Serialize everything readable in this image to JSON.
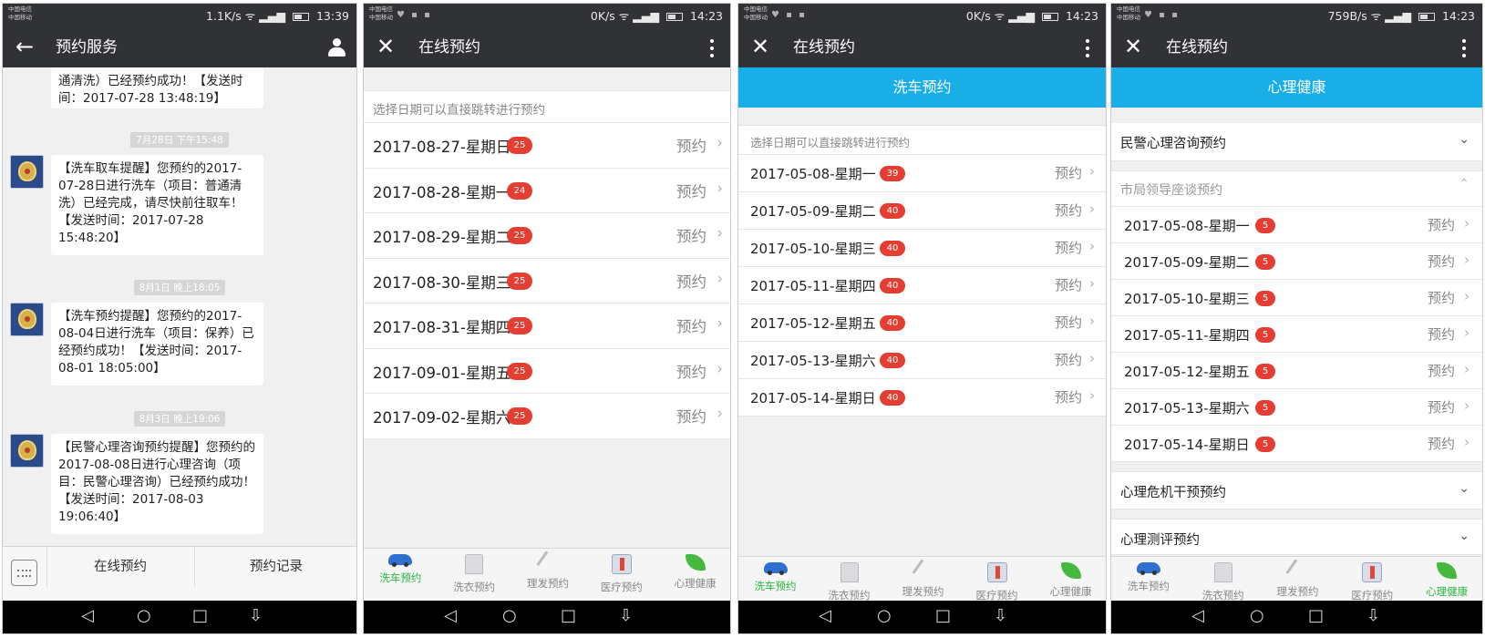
{
  "colors": {
    "accent_blue": "#1AAEE8",
    "badge_red": "#E43E32",
    "tab_active_green": "#2BB63D",
    "bar_dark": "#303236"
  },
  "screens": [
    {
      "status": {
        "carrier1": "中国电信",
        "carrier2": "中国移动",
        "speed": "1.1K/s",
        "time": "13:39"
      },
      "header": {
        "back_icon": "←",
        "title": "预约服务",
        "profile_icon": "person-icon"
      },
      "messages": [
        {
          "text": "通清洗）已经预约成功！【发送时间：2017-07-28 13:48:19】"
        },
        {
          "stamp": "7月28日 下午15:48",
          "text": "【洗车取车提醒】您预约的2017-07-28日进行洗车（项目：普通清洗）已经完成，请尽快前往取车！【发送时间：2017-07-28 15:48:20】"
        },
        {
          "stamp": "8月1日 晚上18:05",
          "text": "【洗车预约提醒】您预约的2017-08-04日进行洗车（项目：保养）已经预约成功！【发送时间：2017-08-01 18:05:00】"
        },
        {
          "stamp": "8月3日 晚上19:06",
          "text": "【民警心理咨询预约提醒】您预约的2017-08-08日进行心理咨询（项目：民警心理咨询）已经预约成功！【发送时间：2017-08-03 19:06:40】"
        }
      ],
      "bottom": {
        "left": "在线预约",
        "right": "预约记录"
      }
    },
    {
      "status": {
        "carrier1": "中国电信",
        "carrier2": "中国移动",
        "speed": "0K/s",
        "time": "14:23"
      },
      "header": {
        "title": "在线预约"
      },
      "hint": "选择日期可以直接跳转进行预约",
      "rows": [
        {
          "date": "2017-08-27-星期日",
          "count": "25"
        },
        {
          "date": "2017-08-28-星期一",
          "count": "24"
        },
        {
          "date": "2017-08-29-星期二",
          "count": "25"
        },
        {
          "date": "2017-08-30-星期三",
          "count": "25"
        },
        {
          "date": "2017-08-31-星期四",
          "count": "25"
        },
        {
          "date": "2017-09-01-星期五",
          "count": "25"
        },
        {
          "date": "2017-09-02-星期六",
          "count": "25"
        }
      ],
      "action": "预约",
      "tabs": [
        "洗车预约",
        "洗衣预约",
        "理发预约",
        "医疗预约",
        "心理健康"
      ]
    },
    {
      "status": {
        "carrier1": "中国电信",
        "carrier2": "中国移动",
        "speed": "0K/s",
        "time": "14:23"
      },
      "header": {
        "title": "在线预约"
      },
      "banner": "洗车预约",
      "hint": "选择日期可以直接跳转进行预约",
      "rows": [
        {
          "date": "2017-05-08-星期一",
          "count": "39"
        },
        {
          "date": "2017-05-09-星期二",
          "count": "40"
        },
        {
          "date": "2017-05-10-星期三",
          "count": "40"
        },
        {
          "date": "2017-05-11-星期四",
          "count": "40"
        },
        {
          "date": "2017-05-12-星期五",
          "count": "40"
        },
        {
          "date": "2017-05-13-星期六",
          "count": "40"
        },
        {
          "date": "2017-05-14-星期日",
          "count": "40"
        }
      ],
      "action": "预约",
      "tabs": [
        "洗车预约",
        "洗衣预约",
        "理发预约",
        "医疗预约",
        "心理健康"
      ]
    },
    {
      "status": {
        "carrier1": "中国电信",
        "carrier2": "中国移动",
        "speed": "759B/s",
        "time": "14:23"
      },
      "header": {
        "title": "在线预约"
      },
      "banner": "心理健康",
      "sections": [
        "民警心理咨询预约",
        "市局领导座谈预约",
        "心理危机干预预约",
        "心理测评预约"
      ],
      "rows": [
        {
          "date": "2017-05-08-星期一",
          "count": "5"
        },
        {
          "date": "2017-05-09-星期二",
          "count": "5"
        },
        {
          "date": "2017-05-10-星期三",
          "count": "5"
        },
        {
          "date": "2017-05-11-星期四",
          "count": "5"
        },
        {
          "date": "2017-05-12-星期五",
          "count": "5"
        },
        {
          "date": "2017-05-13-星期六",
          "count": "5"
        },
        {
          "date": "2017-05-14-星期日",
          "count": "5"
        }
      ],
      "action": "预约",
      "tabs": [
        "洗车预约",
        "洗衣预约",
        "理发预约",
        "医疗预约",
        "心理健康"
      ]
    }
  ]
}
